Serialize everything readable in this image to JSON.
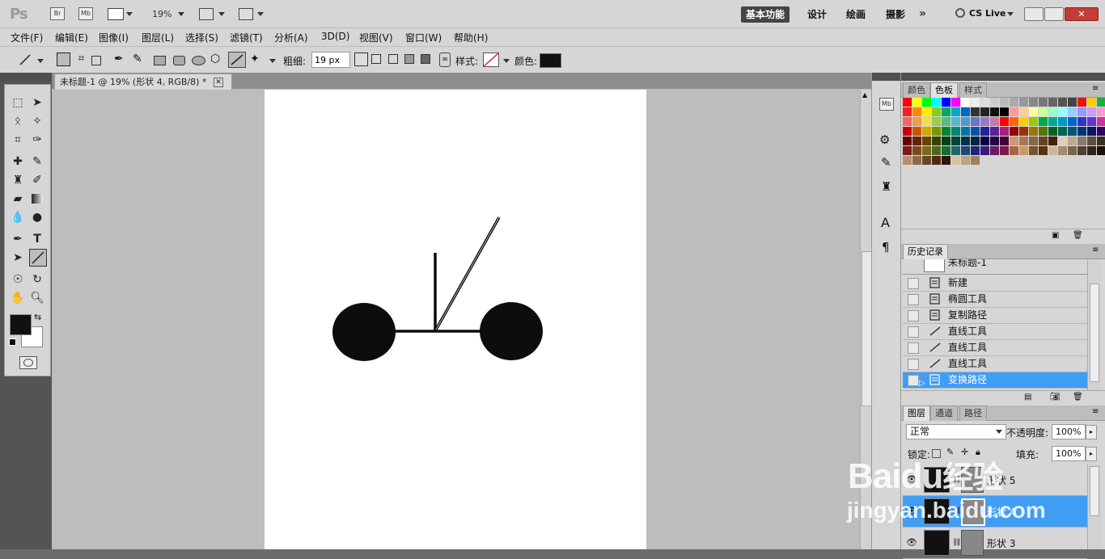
{
  "app": {
    "logo": "Ps",
    "app_icons": [
      "Br",
      "Mb"
    ],
    "zoom": "19%",
    "workspaces": [
      "基本功能",
      "设计",
      "绘画",
      "摄影"
    ],
    "cs_live": "CS Live"
  },
  "menubar": [
    "文件(F)",
    "编辑(E)",
    "图像(I)",
    "图层(L)",
    "选择(S)",
    "滤镜(T)",
    "分析(A)",
    "3D(D)",
    "视图(V)",
    "窗口(W)",
    "帮助(H)"
  ],
  "options": {
    "weight_label": "粗细:",
    "weight_value": "19 px",
    "style_label": "样式:",
    "color_label": "颜色:",
    "color": "#111111"
  },
  "document": {
    "tab_title": "未标题-1 @ 19% (形状 4, RGB/8) *"
  },
  "swatches_panel": {
    "tabs": [
      "颜色",
      "色板",
      "样式"
    ],
    "active_tab": "色板"
  },
  "history_panel": {
    "title": "历史记录",
    "snapshot_label": "未标题-1",
    "items": [
      {
        "label": "新建",
        "icon": "doc-icon"
      },
      {
        "label": "椭圆工具",
        "icon": "doc-icon"
      },
      {
        "label": "复制路径",
        "icon": "doc-icon"
      },
      {
        "label": "直线工具",
        "icon": "line-icon"
      },
      {
        "label": "直线工具",
        "icon": "line-icon"
      },
      {
        "label": "直线工具",
        "icon": "line-icon"
      },
      {
        "label": "变换路径",
        "icon": "doc-icon",
        "selected": true
      }
    ]
  },
  "layers_panel": {
    "tabs": [
      "图层",
      "通道",
      "路径"
    ],
    "blend_mode": "正常",
    "opacity_label": "不透明度:",
    "opacity": "100%",
    "lock_label": "锁定:",
    "fill_label": "填充:",
    "fill": "100%",
    "layers": [
      {
        "name": "形状 5",
        "selected": false
      },
      {
        "name": "形状 4",
        "selected": true
      },
      {
        "name": "形状 3",
        "selected": false
      }
    ]
  },
  "watermark": {
    "brand": "Baidu",
    "brand_cn": "经验",
    "url": "jingyan.baidu.com"
  }
}
